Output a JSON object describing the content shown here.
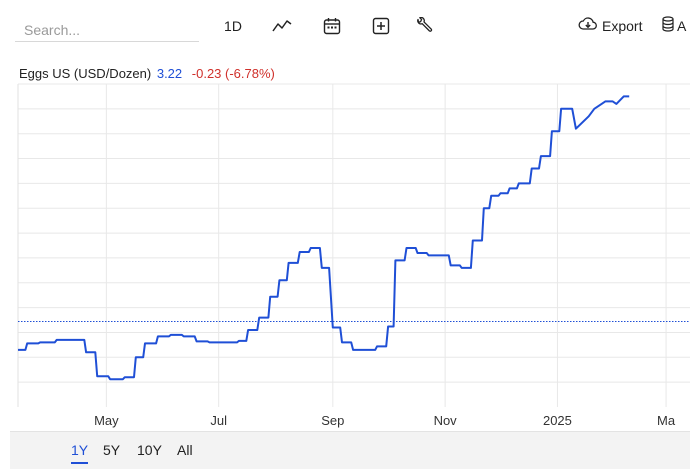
{
  "toolbar": {
    "search_placeholder": "Search...",
    "interval_label": "1D",
    "export_label": "Export",
    "data_label_partial": "A",
    "icons": [
      "line-chart-icon",
      "calendar-icon",
      "add-indicator-icon",
      "wrench-icon",
      "cloud-download-icon",
      "database-icon"
    ]
  },
  "legend": {
    "symbol": "Eggs US (USD/Dozen)",
    "price": "3.22",
    "change": "-0.23 (-6.78%)"
  },
  "colors": {
    "line": "#1f4fd6",
    "change_negative": "#d0302b",
    "grid": "#e8e8e8",
    "active_range": "#1f4fd6"
  },
  "chart_data": {
    "type": "line",
    "xlabel": "",
    "ylabel": "",
    "x_ticks": [
      "May",
      "Jul",
      "Sep",
      "Nov",
      "2025",
      "Ma"
    ],
    "x_range": [
      "2024-03-14",
      "2025-03-14"
    ],
    "ylim": [
      1.5,
      8.0
    ],
    "grid": true,
    "last_value_line": 3.22,
    "series": [
      {
        "points": [
          [
            "2024-03-14",
            2.65
          ],
          [
            "2024-03-18",
            2.65
          ],
          [
            "2024-03-19",
            2.78
          ],
          [
            "2024-03-25",
            2.78
          ],
          [
            "2024-03-26",
            2.8
          ],
          [
            "2024-04-03",
            2.8
          ],
          [
            "2024-04-04",
            2.85
          ],
          [
            "2024-04-19",
            2.85
          ],
          [
            "2024-04-20",
            2.6
          ],
          [
            "2024-04-25",
            2.6
          ],
          [
            "2024-04-26",
            2.12
          ],
          [
            "2024-05-02",
            2.12
          ],
          [
            "2024-05-03",
            2.06
          ],
          [
            "2024-05-10",
            2.06
          ],
          [
            "2024-05-11",
            2.1
          ],
          [
            "2024-05-16",
            2.1
          ],
          [
            "2024-05-17",
            2.5
          ],
          [
            "2024-05-21",
            2.5
          ],
          [
            "2024-05-22",
            2.78
          ],
          [
            "2024-05-28",
            2.78
          ],
          [
            "2024-05-29",
            2.92
          ],
          [
            "2024-06-04",
            2.92
          ],
          [
            "2024-06-05",
            2.95
          ],
          [
            "2024-06-11",
            2.95
          ],
          [
            "2024-06-12",
            2.92
          ],
          [
            "2024-06-18",
            2.92
          ],
          [
            "2024-06-19",
            2.82
          ],
          [
            "2024-06-25",
            2.82
          ],
          [
            "2024-06-26",
            2.8
          ],
          [
            "2024-07-11",
            2.8
          ],
          [
            "2024-07-12",
            2.83
          ],
          [
            "2024-07-16",
            2.83
          ],
          [
            "2024-07-17",
            3.05
          ],
          [
            "2024-07-22",
            3.05
          ],
          [
            "2024-07-23",
            3.3
          ],
          [
            "2024-07-28",
            3.3
          ],
          [
            "2024-07-29",
            3.72
          ],
          [
            "2024-08-02",
            3.72
          ],
          [
            "2024-08-03",
            4.05
          ],
          [
            "2024-08-07",
            4.05
          ],
          [
            "2024-08-08",
            4.4
          ],
          [
            "2024-08-13",
            4.4
          ],
          [
            "2024-08-14",
            4.62
          ],
          [
            "2024-08-19",
            4.62
          ],
          [
            "2024-08-20",
            4.7
          ],
          [
            "2024-08-25",
            4.7
          ],
          [
            "2024-08-26",
            4.3
          ],
          [
            "2024-08-30",
            4.3
          ],
          [
            "2024-09-01",
            3.1
          ],
          [
            "2024-09-05",
            3.1
          ],
          [
            "2024-09-06",
            2.8
          ],
          [
            "2024-09-11",
            2.8
          ],
          [
            "2024-09-12",
            2.65
          ],
          [
            "2024-09-24",
            2.65
          ],
          [
            "2024-09-25",
            2.72
          ],
          [
            "2024-09-30",
            2.72
          ],
          [
            "2024-10-01",
            3.12
          ],
          [
            "2024-10-04",
            3.12
          ],
          [
            "2024-10-05",
            4.45
          ],
          [
            "2024-10-10",
            4.45
          ],
          [
            "2024-10-11",
            4.7
          ],
          [
            "2024-10-16",
            4.7
          ],
          [
            "2024-10-17",
            4.6
          ],
          [
            "2024-10-22",
            4.6
          ],
          [
            "2024-10-23",
            4.55
          ],
          [
            "2024-11-03",
            4.55
          ],
          [
            "2024-11-04",
            4.35
          ],
          [
            "2024-11-09",
            4.35
          ],
          [
            "2024-11-10",
            4.3
          ],
          [
            "2024-11-15",
            4.3
          ],
          [
            "2024-11-16",
            4.85
          ],
          [
            "2024-11-21",
            4.85
          ],
          [
            "2024-11-22",
            5.5
          ],
          [
            "2024-11-25",
            5.5
          ],
          [
            "2024-11-26",
            5.75
          ],
          [
            "2024-11-30",
            5.75
          ],
          [
            "2024-12-01",
            5.8
          ],
          [
            "2024-12-05",
            5.8
          ],
          [
            "2024-12-06",
            5.9
          ],
          [
            "2024-12-10",
            5.9
          ],
          [
            "2024-12-11",
            6.0
          ],
          [
            "2024-12-17",
            6.0
          ],
          [
            "2024-12-18",
            6.3
          ],
          [
            "2024-12-22",
            6.3
          ],
          [
            "2024-12-23",
            6.55
          ],
          [
            "2024-12-28",
            6.55
          ],
          [
            "2024-12-29",
            7.05
          ],
          [
            "2025-01-02",
            7.05
          ],
          [
            "2025-01-03",
            7.5
          ],
          [
            "2025-01-09",
            7.5
          ],
          [
            "2025-01-11",
            7.1
          ],
          [
            "2025-01-18",
            7.35
          ],
          [
            "2025-01-21",
            7.5
          ],
          [
            "2025-01-25",
            7.6
          ],
          [
            "2025-01-27",
            7.65
          ],
          [
            "2025-01-31",
            7.65
          ],
          [
            "2025-02-02",
            7.6
          ],
          [
            "2025-02-06",
            7.75
          ],
          [
            "2025-02-09",
            7.75
          ]
        ]
      }
    ]
  },
  "range_buttons": [
    {
      "label": "1Y",
      "active": true
    },
    {
      "label": "5Y",
      "active": false
    },
    {
      "label": "10Y",
      "active": false
    },
    {
      "label": "All",
      "active": false
    }
  ]
}
